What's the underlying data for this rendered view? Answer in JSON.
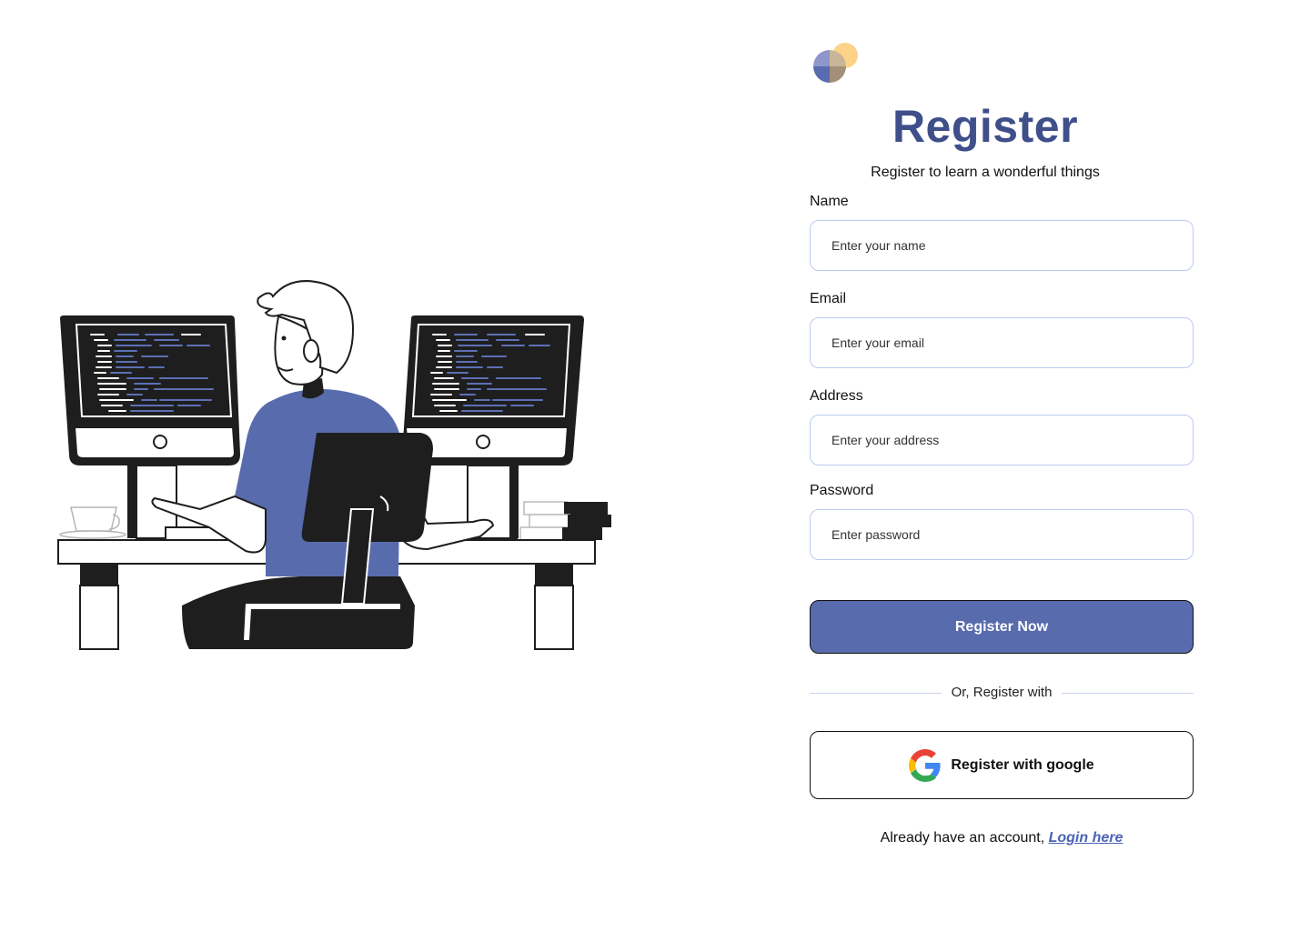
{
  "header": {
    "title": "Register",
    "subtitle": "Register to learn a wonderful things"
  },
  "form": {
    "name": {
      "label": "Name",
      "placeholder": "Enter your name"
    },
    "email": {
      "label": "Email",
      "placeholder": "Enter your email"
    },
    "address": {
      "label": "Address",
      "placeholder": "Enter your address"
    },
    "password": {
      "label": "Password",
      "placeholder": "Enter password"
    },
    "submit_label": "Register Now"
  },
  "divider_text": "Or, Register with",
  "google": {
    "label": "Register with google",
    "icon": "google-icon"
  },
  "footer": {
    "prompt": "Already have an account, ",
    "link_label": "Login here"
  },
  "illustration": {
    "icon": "developer-at-desk-illustration"
  },
  "logo": {
    "icon": "brand-logo-icon"
  },
  "colors": {
    "brand": "#3f4f8a",
    "primary_button": "#586bad",
    "link": "#4c63b6",
    "input_border": "#bccbf0",
    "logo_yellow": "#fdd38a",
    "logo_purple": "#8e96cc",
    "logo_brown": "#a48f78",
    "logo_blue": "#5a6bb0"
  }
}
